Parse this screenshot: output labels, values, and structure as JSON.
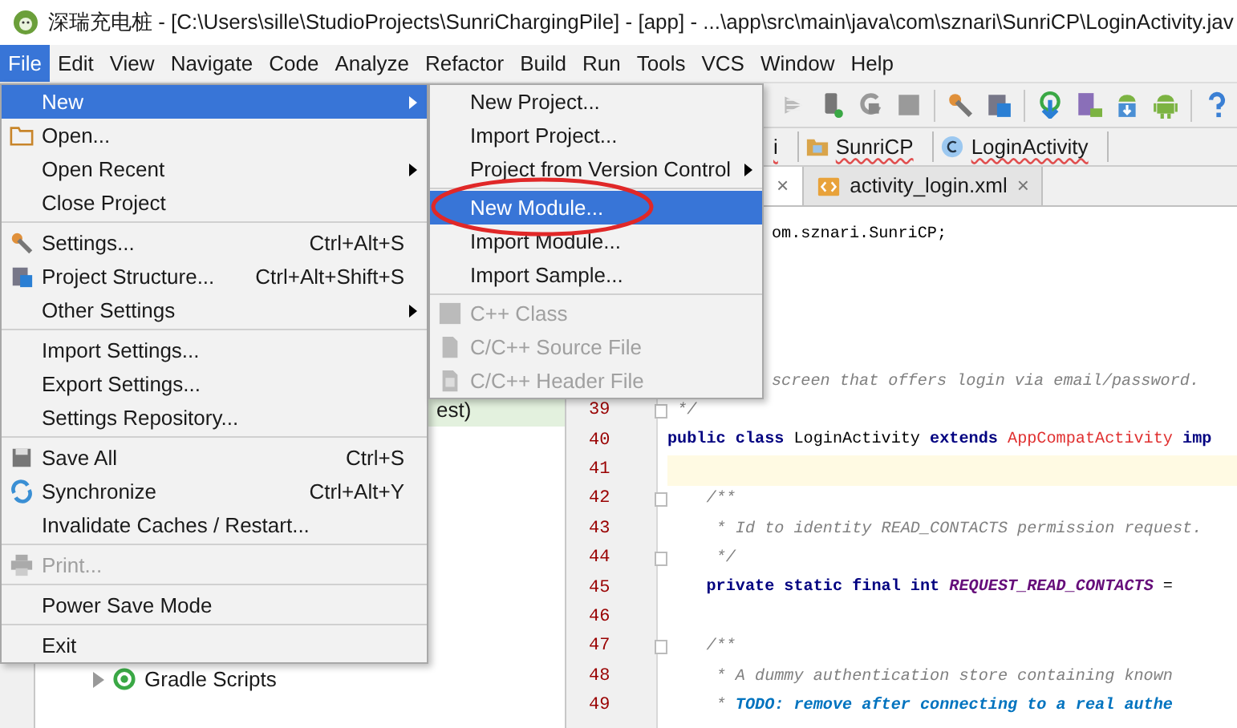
{
  "window": {
    "title": "深瑞充电桩 - [C:\\Users\\sille\\StudioProjects\\SunriChargingPile] - [app] - ...\\app\\src\\main\\java\\com\\sznari\\SunriCP\\LoginActivity.jav"
  },
  "menubar": [
    {
      "label": "File",
      "selected": true
    },
    {
      "label": "Edit",
      "selected": false
    },
    {
      "label": "View",
      "selected": false
    },
    {
      "label": "Navigate",
      "selected": false
    },
    {
      "label": "Code",
      "selected": false
    },
    {
      "label": "Analyze",
      "selected": false
    },
    {
      "label": "Refactor",
      "selected": false
    },
    {
      "label": "Build",
      "selected": false
    },
    {
      "label": "Run",
      "selected": false
    },
    {
      "label": "Tools",
      "selected": false
    },
    {
      "label": "VCS",
      "selected": false
    },
    {
      "label": "Window",
      "selected": false
    },
    {
      "label": "Help",
      "selected": false
    }
  ],
  "breadcrumbs": [
    {
      "label": "i"
    },
    {
      "label": "SunriCP"
    },
    {
      "label": "LoginActivity"
    }
  ],
  "tabs": [
    {
      "close": "×",
      "selected": true
    },
    {
      "label": "activity_login.xml",
      "close": "×",
      "selected": false
    }
  ],
  "project_tree": [
    {
      "label": "est)",
      "selected": true
    },
    {
      "label": "Gradle Scripts",
      "selected": false
    }
  ],
  "editor": {
    "lines": [
      {
        "code": [
          {
            "kind": "plain",
            "text": "om.sznari.SunriCP;"
          }
        ]
      },
      {
        "code": [
          {
            "kind": "comment",
            "text": "screen that offers login via email/password."
          }
        ]
      },
      {
        "number": "39",
        "code": [
          {
            "kind": "comment",
            "text": " */"
          }
        ],
        "current": false,
        "fold": true
      },
      {
        "number": "40",
        "code": [
          {
            "kind": "keyword",
            "text": "public class"
          },
          {
            "kind": "plain",
            "text": " LoginActivity "
          },
          {
            "kind": "keyword",
            "text": "extends"
          },
          {
            "kind": "type",
            "text": " AppCompatActivity "
          },
          {
            "kind": "keyword",
            "text": "imp"
          }
        ],
        "current": false,
        "fold": false
      },
      {
        "number": "41",
        "current": true,
        "fold": false
      },
      {
        "number": "42",
        "code": [
          {
            "kind": "comment",
            "text": "    /**"
          }
        ],
        "current": false,
        "fold": true
      },
      {
        "number": "43",
        "code": [
          {
            "kind": "comment",
            "text": "     * Id to identity READ_CONTACTS permission request."
          }
        ],
        "current": false,
        "fold": false
      },
      {
        "number": "44",
        "code": [
          {
            "kind": "comment",
            "text": "     */"
          }
        ],
        "current": false,
        "fold": true
      },
      {
        "number": "45",
        "code": [
          {
            "kind": "keyword",
            "text": "    private static final int "
          },
          {
            "kind": "constant",
            "text": "REQUEST_READ_CONTACTS"
          },
          {
            "kind": "plain",
            "text": " ="
          }
        ],
        "current": false,
        "fold": false
      },
      {
        "number": "46",
        "current": false,
        "fold": false
      },
      {
        "number": "47",
        "code": [
          {
            "kind": "comment",
            "text": "    /**"
          }
        ],
        "current": false,
        "fold": true
      },
      {
        "number": "48",
        "code": [
          {
            "kind": "comment",
            "text": "     * A dummy authentication store containing known"
          }
        ],
        "current": false,
        "fold": false
      },
      {
        "number": "49",
        "code": [
          {
            "kind": "comment",
            "text": "     * "
          },
          {
            "kind": "todo",
            "text": "TODO: remove after connecting to a real authe"
          }
        ],
        "current": false,
        "fold": false
      }
    ]
  },
  "file_menu": {
    "items": [
      {
        "kind": "item",
        "label": "New",
        "submenu": true,
        "selected": true,
        "disabled": false
      },
      {
        "kind": "item",
        "label": "Open...",
        "submenu": false,
        "selected": false,
        "disabled": false
      },
      {
        "kind": "item",
        "label": "Open Recent",
        "submenu": true,
        "selected": false,
        "disabled": false
      },
      {
        "kind": "item",
        "label": "Close Project",
        "submenu": false,
        "selected": false,
        "disabled": false
      },
      {
        "kind": "separator"
      },
      {
        "kind": "item",
        "label": "Settings...",
        "shortcut": "Ctrl+Alt+S",
        "submenu": false,
        "selected": false,
        "disabled": false
      },
      {
        "kind": "item",
        "label": "Project Structure...",
        "shortcut": "Ctrl+Alt+Shift+S",
        "submenu": false,
        "selected": false,
        "disabled": false
      },
      {
        "kind": "item",
        "label": "Other Settings",
        "submenu": true,
        "selected": false,
        "disabled": false
      },
      {
        "kind": "separator"
      },
      {
        "kind": "item",
        "label": "Import Settings...",
        "submenu": false,
        "selected": false,
        "disabled": false
      },
      {
        "kind": "item",
        "label": "Export Settings...",
        "submenu": false,
        "selected": false,
        "disabled": false
      },
      {
        "kind": "item",
        "label": "Settings Repository...",
        "submenu": false,
        "selected": false,
        "disabled": false
      },
      {
        "kind": "separator"
      },
      {
        "kind": "item",
        "label": "Save All",
        "shortcut": "Ctrl+S",
        "submenu": false,
        "selected": false,
        "disabled": false
      },
      {
        "kind": "item",
        "label": "Synchronize",
        "shortcut": "Ctrl+Alt+Y",
        "submenu": false,
        "selected": false,
        "disabled": false
      },
      {
        "kind": "item",
        "label": "Invalidate Caches / Restart...",
        "submenu": false,
        "selected": false,
        "disabled": false
      },
      {
        "kind": "separator"
      },
      {
        "kind": "item",
        "label": "Print...",
        "submenu": false,
        "selected": false,
        "disabled": true
      },
      {
        "kind": "separator"
      },
      {
        "kind": "item",
        "label": "Power Save Mode",
        "submenu": false,
        "selected": false,
        "disabled": false
      },
      {
        "kind": "separator"
      },
      {
        "kind": "item",
        "label": "Exit",
        "submenu": false,
        "selected": false,
        "disabled": false
      }
    ]
  },
  "new_submenu": {
    "items": [
      {
        "kind": "item",
        "label": "New Project...",
        "submenu": false,
        "selected": false,
        "disabled": false
      },
      {
        "kind": "item",
        "label": "Import Project...",
        "submenu": false,
        "selected": false,
        "disabled": false
      },
      {
        "kind": "item",
        "label": "Project from Version Control",
        "submenu": true,
        "selected": false,
        "disabled": false
      },
      {
        "kind": "separator"
      },
      {
        "kind": "item",
        "label": "New Module...",
        "submenu": false,
        "selected": true,
        "disabled": false,
        "circled": true
      },
      {
        "kind": "item",
        "label": "Import Module...",
        "submenu": false,
        "selected": false,
        "disabled": false
      },
      {
        "kind": "item",
        "label": "Import Sample...",
        "submenu": false,
        "selected": false,
        "disabled": false
      },
      {
        "kind": "separator"
      },
      {
        "kind": "item",
        "label": "C++ Class",
        "submenu": false,
        "selected": false,
        "disabled": true
      },
      {
        "kind": "item",
        "label": "C/C++ Source File",
        "submenu": false,
        "selected": false,
        "disabled": true
      },
      {
        "kind": "item",
        "label": "C/C++ Header File",
        "submenu": false,
        "selected": false,
        "disabled": true
      }
    ]
  }
}
